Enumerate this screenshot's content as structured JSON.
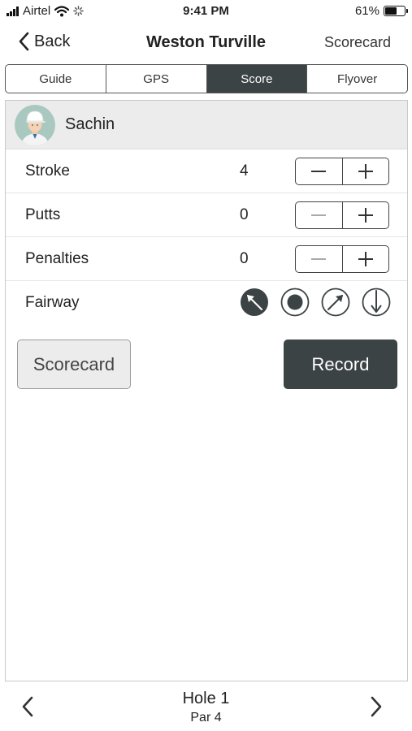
{
  "status_bar": {
    "carrier": "Airtel",
    "time": "9:41 PM",
    "battery_percent": "61%",
    "battery_level": 0.61
  },
  "nav": {
    "back_label": "Back",
    "title": "Weston Turville",
    "right_label": "Scorecard"
  },
  "tabs": [
    {
      "label": "Guide",
      "active": false
    },
    {
      "label": "GPS",
      "active": false
    },
    {
      "label": "Score",
      "active": true
    },
    {
      "label": "Flyover",
      "active": false
    }
  ],
  "player": {
    "name": "Sachin"
  },
  "stats": {
    "stroke": {
      "label": "Stroke",
      "value": "4"
    },
    "putts": {
      "label": "Putts",
      "value": "0"
    },
    "penalties": {
      "label": "Penalties",
      "value": "0"
    }
  },
  "fairway": {
    "label": "Fairway",
    "options": [
      "fairway-left-icon",
      "fairway-hit-icon",
      "fairway-right-icon",
      "fairway-short-icon"
    ],
    "selected": "fairway-left-icon"
  },
  "actions": {
    "scorecard_label": "Scorecard",
    "record_label": "Record"
  },
  "footer": {
    "hole_label": "Hole 1",
    "par_label": "Par 4"
  },
  "colors": {
    "accent_dark": "#3b4344",
    "header_gray": "#ececec"
  }
}
